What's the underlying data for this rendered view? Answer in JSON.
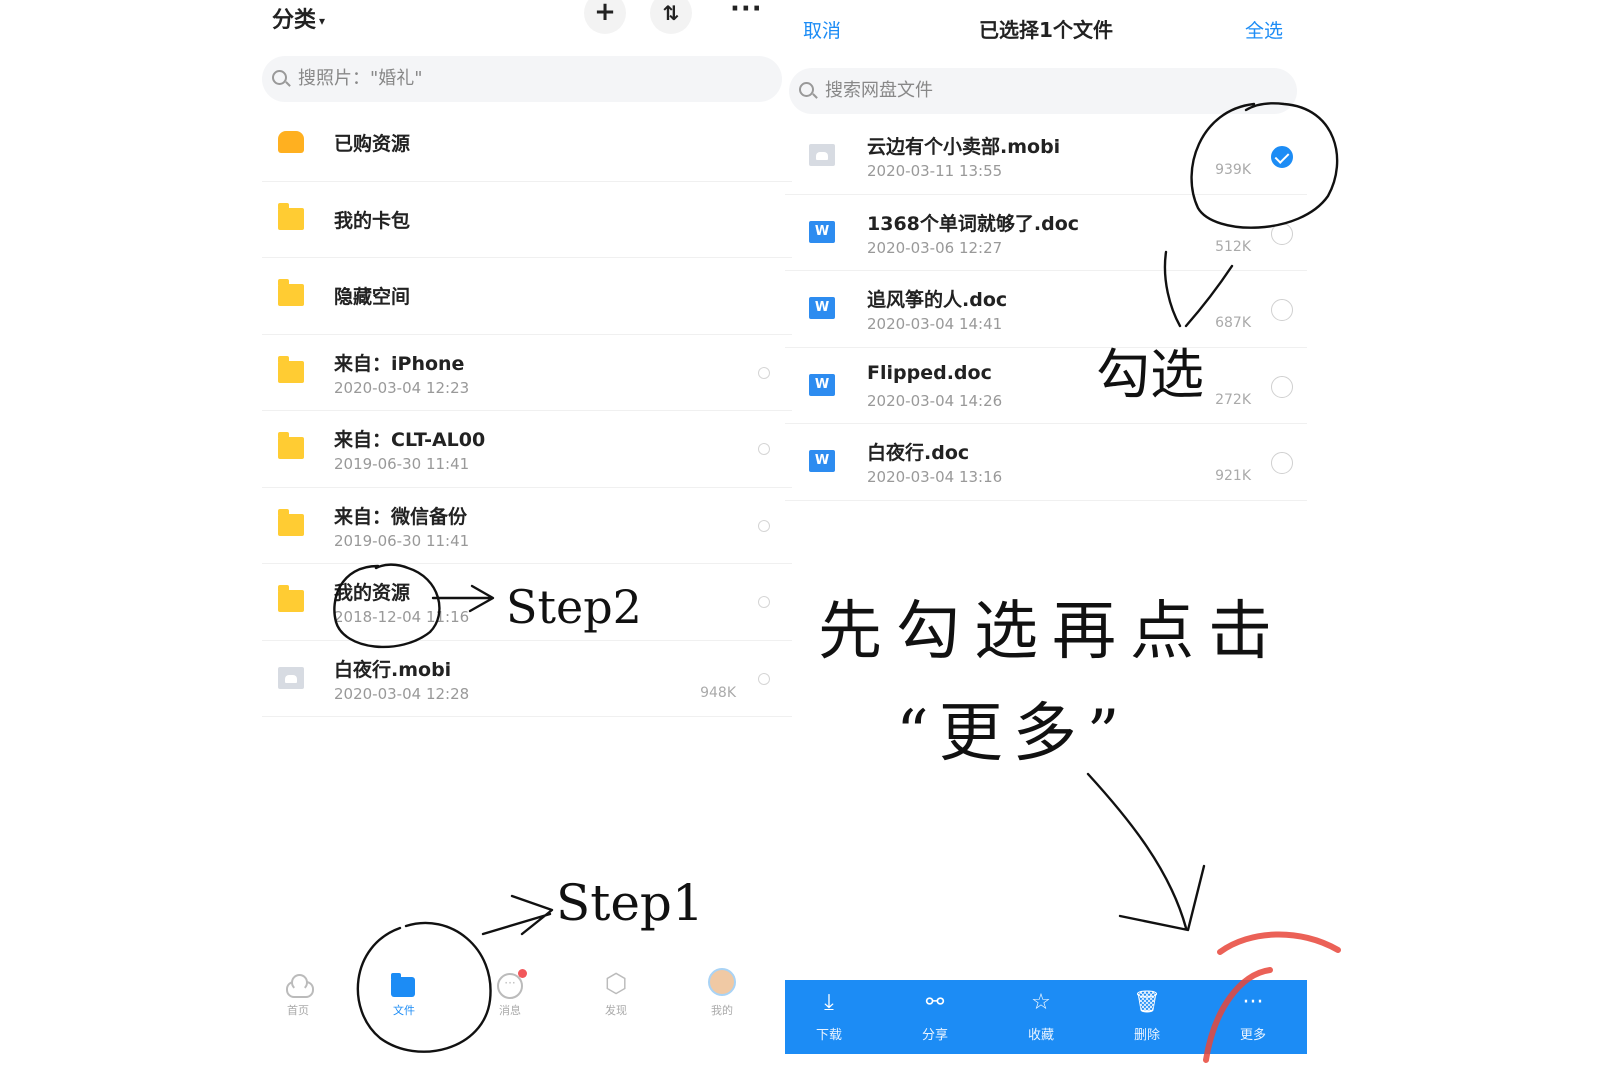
{
  "left": {
    "category_label": "分类",
    "caret": "▾",
    "plus": "+",
    "transfer": "⇅",
    "more": "···",
    "search_placeholder": "搜照片：\"婚礼\"",
    "items": [
      {
        "name": "已购资源",
        "date": "",
        "size": "",
        "icon": "folder-orange-icon"
      },
      {
        "name": "我的卡包",
        "date": "",
        "size": "",
        "icon": "folder-icon"
      },
      {
        "name": "隐藏空间",
        "date": "",
        "size": "",
        "icon": "folder-icon"
      },
      {
        "name": "来自：iPhone",
        "date": "2020-03-04 12:23",
        "size": "",
        "icon": "folder-icon"
      },
      {
        "name": "来自：CLT-AL00",
        "date": "2019-06-30 11:41",
        "size": "",
        "icon": "folder-icon"
      },
      {
        "name": "来自：微信备份",
        "date": "2019-06-30 11:41",
        "size": "",
        "icon": "folder-icon"
      },
      {
        "name": "我的资源",
        "date": "2018-12-04 11:16",
        "size": "",
        "icon": "folder-icon"
      },
      {
        "name": "白夜行.mobi",
        "date": "2020-03-04 12:28",
        "size": "948K",
        "icon": "document-icon"
      }
    ],
    "tabs": [
      {
        "label": "首页",
        "icon": "cloud-icon"
      },
      {
        "label": "文件",
        "icon": "file-folder-icon",
        "active": true
      },
      {
        "label": "消息",
        "icon": "message-icon"
      },
      {
        "label": "发现",
        "icon": "discover-icon"
      },
      {
        "label": "我的",
        "icon": "avatar-icon"
      }
    ]
  },
  "right": {
    "cancel": "取消",
    "title": "已选择1个文件",
    "select_all": "全选",
    "search_placeholder": "搜索网盘文件",
    "files": [
      {
        "name": "云边有个小卖部.mobi",
        "date": "2020-03-11 13:55",
        "size": "939K",
        "checked": true,
        "icon": "document-icon"
      },
      {
        "name": "1368个单词就够了.doc",
        "date": "2020-03-06 12:27",
        "size": "512K",
        "checked": false,
        "icon": "word-icon"
      },
      {
        "name": "追风筝的人.doc",
        "date": "2020-03-04 14:41",
        "size": "687K",
        "checked": false,
        "icon": "word-icon"
      },
      {
        "name": "Flipped.doc",
        "date": "2020-03-04 14:26",
        "size": "272K",
        "checked": false,
        "icon": "word-icon"
      },
      {
        "name": "白夜行.doc",
        "date": "2020-03-04 13:16",
        "size": "921K",
        "checked": false,
        "icon": "word-icon"
      }
    ],
    "actions": [
      {
        "label": "下载",
        "icon": "download-icon",
        "glyph": "⤓"
      },
      {
        "label": "分享",
        "icon": "share-icon",
        "glyph": "⚯"
      },
      {
        "label": "收藏",
        "icon": "star-icon",
        "glyph": "☆"
      },
      {
        "label": "删除",
        "icon": "trash-icon",
        "glyph": "🗑"
      },
      {
        "label": "更多",
        "icon": "more-icon",
        "glyph": "···"
      }
    ]
  },
  "annotations": {
    "step1": "Step1",
    "step2": "Step2",
    "check_note": "勾选",
    "instruction_line1": "先勾选再点击",
    "instruction_line2": "“更多”"
  },
  "colors": {
    "accent": "#1c8cf5",
    "folder": "#ffcc33",
    "badge": "#f2575b",
    "highlight_ink": "#e8463a"
  }
}
